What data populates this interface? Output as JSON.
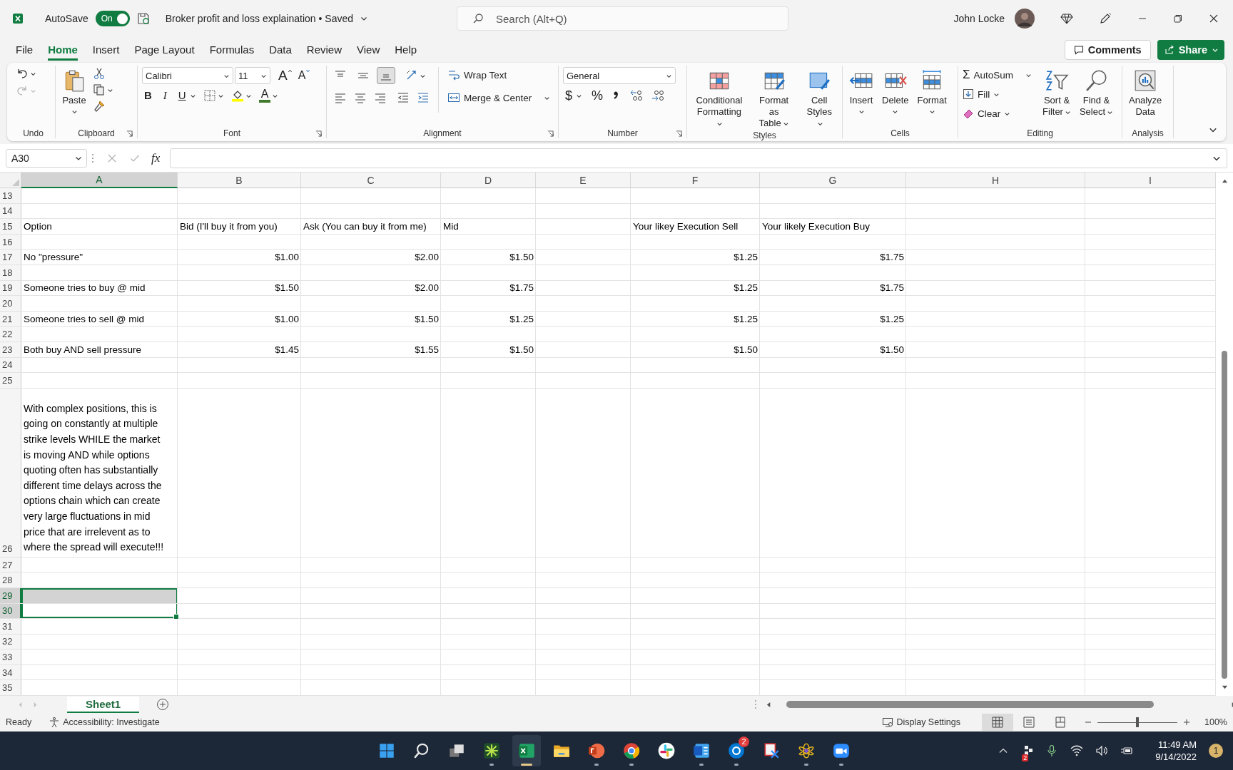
{
  "title_bar": {
    "autosave": {
      "label": "AutoSave",
      "state": "On",
      "on": true
    },
    "document_title": "Broker profit and loss explaination • Saved",
    "search_placeholder": "Search (Alt+Q)",
    "user_name": "John Locke"
  },
  "menu_tabs": [
    {
      "label": "File",
      "selected": false
    },
    {
      "label": "Home",
      "selected": true
    },
    {
      "label": "Insert",
      "selected": false
    },
    {
      "label": "Page Layout",
      "selected": false
    },
    {
      "label": "Formulas",
      "selected": false
    },
    {
      "label": "Data",
      "selected": false
    },
    {
      "label": "Review",
      "selected": false
    },
    {
      "label": "View",
      "selected": false
    },
    {
      "label": "Help",
      "selected": false
    }
  ],
  "comments_button": "Comments",
  "share_button": "Share",
  "ribbon": {
    "undo": {
      "group": "Undo",
      "redo_disabled": true
    },
    "clipboard": {
      "group": "Clipboard",
      "paste": "Paste"
    },
    "font": {
      "group": "Font",
      "name": "Calibri",
      "size": "11",
      "grow": "A",
      "shrink": "A",
      "bold": "B",
      "italic": "I",
      "underline": "U",
      "color_letter": "A"
    },
    "alignment": {
      "group": "Alignment",
      "vertical": [
        {
          "selected": false
        },
        {
          "selected": false
        },
        {
          "selected": true
        }
      ],
      "wrap_text": "Wrap Text",
      "merge_center": "Merge & Center"
    },
    "number": {
      "group": "Number",
      "format": "General",
      "currency": "$",
      "percent": "%"
    },
    "styles": {
      "group": "Styles",
      "buttons": [
        "Conditional\nFormatting",
        "Format as\nTable",
        "Cell\nStyles"
      ]
    },
    "cells": {
      "group": "Cells",
      "buttons": [
        "Insert",
        "Delete",
        "Format"
      ]
    },
    "editing": {
      "group": "Editing",
      "autosum_symbol": "Σ",
      "autosum": "AutoSum",
      "fill": "Fill",
      "clear": "Clear",
      "buttons": [
        "Sort &\nFilter",
        "Find &\nSelect"
      ]
    },
    "analysis": {
      "group": "Analysis",
      "buttons": [
        "Analyze\nData"
      ]
    }
  },
  "formula_bar": {
    "name_box": "A30",
    "function_label": "fx"
  },
  "columns": [
    {
      "letter": "A",
      "selected": true
    },
    {
      "letter": "B",
      "selected": false
    },
    {
      "letter": "C",
      "selected": false
    },
    {
      "letter": "D",
      "selected": false
    },
    {
      "letter": "E",
      "selected": false
    },
    {
      "letter": "F",
      "selected": false
    },
    {
      "letter": "G",
      "selected": false
    },
    {
      "letter": "H",
      "selected": false
    },
    {
      "letter": "I",
      "selected": false
    }
  ],
  "rows": [
    {
      "number": "13",
      "kind": "blank",
      "selected": false
    },
    {
      "number": "14",
      "kind": "blank",
      "selected": false
    },
    {
      "number": "15",
      "kind": "text",
      "selected": false,
      "cells": {
        "A": "Option",
        "B": "Bid (I'll buy it from you)",
        "C": "Ask (You can buy it from me)",
        "D": "Mid",
        "F": "Your likey Execution Sell",
        "G": "Your likely Execution Buy"
      }
    },
    {
      "number": "16",
      "kind": "blank",
      "selected": false
    },
    {
      "number": "17",
      "kind": "values",
      "selected": false,
      "cells": {
        "A": "No \"pressure\"",
        "B": "$1.00",
        "C": "$2.00",
        "D": "$1.50",
        "F": "$1.25",
        "G": "$1.75"
      }
    },
    {
      "number": "18",
      "kind": "blank",
      "selected": false
    },
    {
      "number": "19",
      "kind": "values",
      "selected": false,
      "cells": {
        "A": "Someone tries to buy @ mid",
        "B": "$1.50",
        "C": "$2.00",
        "D": "$1.75",
        "F": "$1.25",
        "G": "$1.75"
      }
    },
    {
      "number": "20",
      "kind": "blank",
      "selected": false
    },
    {
      "number": "21",
      "kind": "values",
      "selected": false,
      "cells": {
        "A": "Someone tries to sell @ mid",
        "B": "$1.00",
        "C": "$1.50",
        "D": "$1.25",
        "F": "$1.25",
        "G": "$1.25"
      }
    },
    {
      "number": "22",
      "kind": "blank",
      "selected": false
    },
    {
      "number": "23",
      "kind": "values",
      "selected": false,
      "cells": {
        "A": "Both buy AND sell pressure",
        "B": "$1.45",
        "C": "$1.55",
        "D": "$1.50",
        "F": "$1.50",
        "G": "$1.50"
      }
    },
    {
      "number": "24",
      "kind": "blank",
      "selected": false
    },
    {
      "number": "25",
      "kind": "blank",
      "selected": false
    },
    {
      "number": "26",
      "kind": "note",
      "selected": false,
      "cells": {
        "A": "With complex positions, this is going on constantly at multiple strike levels WHILE the market is moving AND while options quoting often has substantially different time delays across the options chain which can create very large fluctuations in mid price that are irrelevent as to where the spread will execute!!!"
      }
    },
    {
      "number": "27",
      "kind": "blank",
      "selected": false
    },
    {
      "number": "28",
      "kind": "blank",
      "selected": false
    },
    {
      "number": "29",
      "kind": "blank",
      "selected": true,
      "active": false
    },
    {
      "number": "30",
      "kind": "blank",
      "selected": true,
      "active": true
    },
    {
      "number": "31",
      "kind": "blank",
      "selected": false
    },
    {
      "number": "32",
      "kind": "blank",
      "selected": false
    },
    {
      "number": "33",
      "kind": "blank",
      "selected": false
    },
    {
      "number": "34",
      "kind": "blank",
      "selected": false
    },
    {
      "number": "35",
      "kind": "blank",
      "selected": false
    }
  ],
  "sheet_tabs": [
    {
      "label": "Sheet1",
      "selected": true
    }
  ],
  "status_bar": {
    "status": "Ready",
    "accessibility": "Accessibility: Investigate",
    "display_settings": "Display Settings",
    "views": [
      {
        "selected": true
      },
      {
        "selected": false
      },
      {
        "selected": false
      }
    ],
    "zoom": {
      "level": 0.5
    },
    "zoom_label": "100%"
  },
  "taskbar": {
    "apps": [
      {
        "running": false,
        "selected": false
      },
      {
        "running": false,
        "selected": false
      },
      {
        "running": false,
        "selected": false
      },
      {
        "running": true,
        "selected": false
      },
      {
        "running": true,
        "selected": true
      },
      {
        "running": false,
        "selected": false
      },
      {
        "running": true,
        "selected": false
      },
      {
        "running": true,
        "selected": false
      },
      {
        "running": false,
        "selected": false
      },
      {
        "running": true,
        "selected": false
      },
      {
        "running": true,
        "selected": false
      },
      {
        "running": false,
        "selected": false
      },
      {
        "running": true,
        "selected": false
      },
      {
        "running": true,
        "selected": false
      }
    ],
    "skype_badge": "2",
    "tray_badge": "2",
    "time": "11:49 AM",
    "date": "9/14/2022",
    "notification_count": "1"
  }
}
